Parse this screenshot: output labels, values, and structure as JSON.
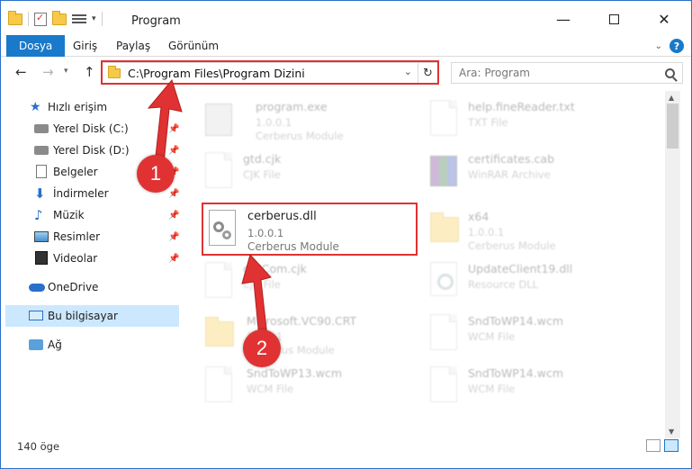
{
  "window": {
    "title": "Program"
  },
  "ribbon": {
    "tabs": [
      "Dosya",
      "Giriş",
      "Paylaş",
      "Görünüm"
    ]
  },
  "address": {
    "path": "C:\\Program Files\\Program Dizini"
  },
  "search": {
    "placeholder": "Ara: Program"
  },
  "nav": {
    "items": [
      {
        "label": "Hızlı erişim",
        "icon": "star-icon"
      },
      {
        "label": "Yerel Disk (C:)",
        "icon": "disk-icon",
        "pinned": true
      },
      {
        "label": "Yerel Disk (D:)",
        "icon": "disk-icon",
        "pinned": true
      },
      {
        "label": "Belgeler",
        "icon": "documents-icon",
        "pinned": true
      },
      {
        "label": "İndirmeler",
        "icon": "downloads-icon",
        "pinned": true
      },
      {
        "label": "Müzik",
        "icon": "music-icon",
        "pinned": true
      },
      {
        "label": "Resimler",
        "icon": "pictures-icon",
        "pinned": true
      },
      {
        "label": "Videolar",
        "icon": "videos-icon",
        "pinned": true
      },
      {
        "label": "OneDrive",
        "icon": "onedrive-icon"
      },
      {
        "label": "Bu bilgisayar",
        "icon": "this-pc-icon",
        "selected": true
      },
      {
        "label": "Ağ",
        "icon": "network-icon"
      }
    ]
  },
  "files": [
    {
      "name": "program.exe",
      "line1": "1.0.0.1",
      "line2": "Cerberus Module",
      "icon": "exe-icon"
    },
    {
      "name": "help.fineReader.txt",
      "line1": "TXT File",
      "line2": "",
      "icon": "text-file-icon"
    },
    {
      "name": "gtd.cjk",
      "line1": "CJK File",
      "line2": "",
      "icon": "file-icon"
    },
    {
      "name": "certificates.cab",
      "line1": "WinRAR Archive",
      "line2": "",
      "icon": "winrar-icon"
    },
    {
      "name": "cerberus.dll",
      "line1": "1.0.0.1",
      "line2": "Cerberus Module",
      "icon": "dll-gear-icon",
      "highlighted": true
    },
    {
      "name": "x64",
      "line1": "1.0.0.1",
      "line2": "Cerberus Module",
      "icon": "folder-icon"
    },
    {
      "name": "gtdCom.cjk",
      "line1": "CJK File",
      "line2": "",
      "icon": "file-icon"
    },
    {
      "name": "UpdateClient19.dll",
      "line1": "Resource DLL",
      "line2": "",
      "icon": "dll-icon"
    },
    {
      "name": "Microsoft.VC90.CRT",
      "line1": "1.0.0.1",
      "line2": "Cerberus Module",
      "icon": "folder-icon"
    },
    {
      "name": "SndToWP14.wcm",
      "line1": "WCM File",
      "line2": "",
      "icon": "file-icon"
    },
    {
      "name": "SndToWP13.wcm",
      "line1": "WCM File",
      "line2": "",
      "icon": "file-icon"
    },
    {
      "name": "SndToWP14.wcm",
      "line1": "WCM File",
      "line2": "",
      "icon": "file-icon"
    }
  ],
  "status": {
    "item_count": "140 öge"
  },
  "callouts": {
    "step1": "1",
    "step2": "2"
  },
  "colors": {
    "accent": "#1979ca",
    "highlight": "#e03232",
    "selection": "#cce8ff"
  }
}
